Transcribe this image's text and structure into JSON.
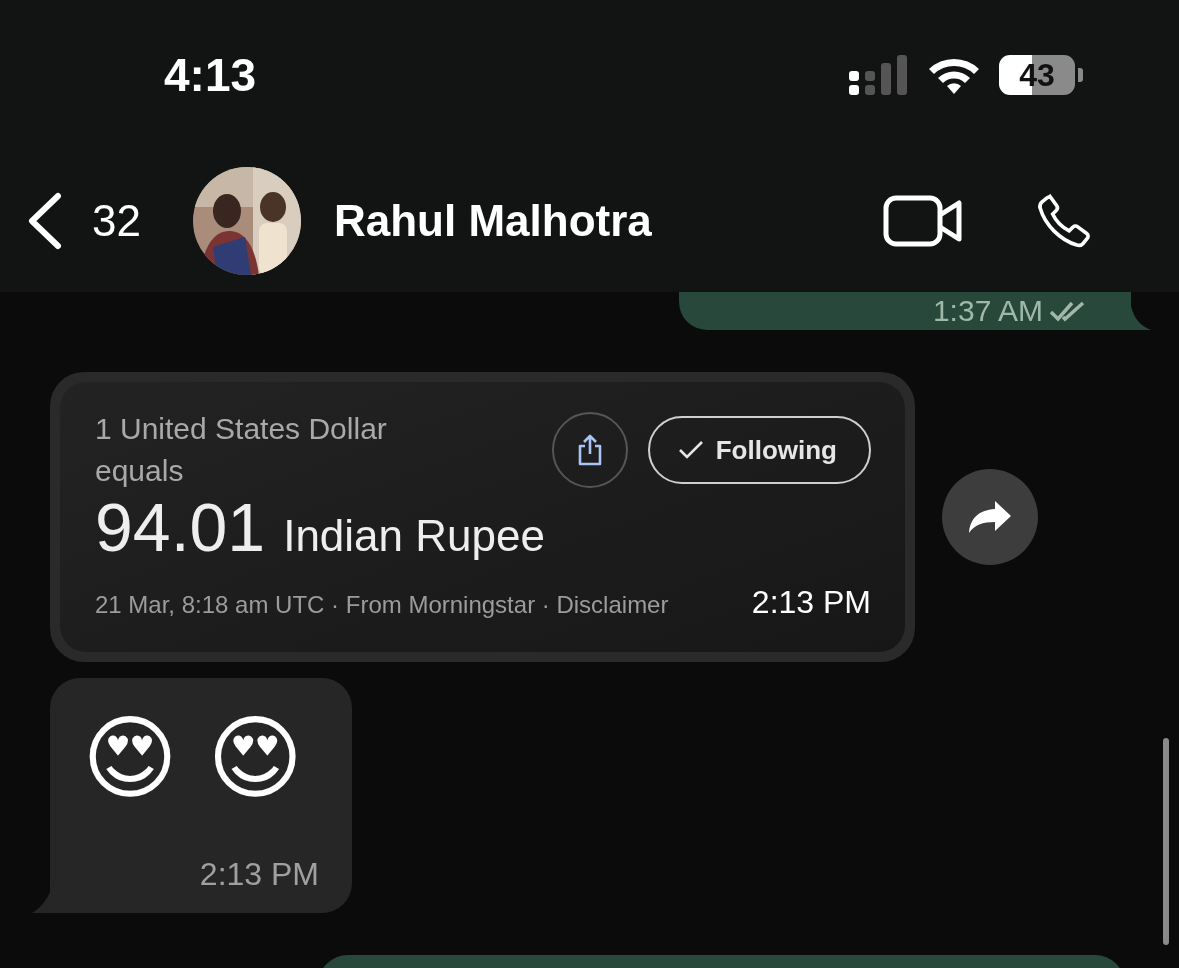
{
  "status_bar": {
    "time": "4:13",
    "battery": "43"
  },
  "header": {
    "back_count": "32",
    "contact_name": "Rahul Malhotra"
  },
  "messages": [
    {
      "kind": "outgoing",
      "time": "1:37 AM"
    },
    {
      "kind": "currency_card",
      "conversion_label": "1 United States Dollar equals",
      "amount": "94.01",
      "currency": "Indian Rupee",
      "follow_button": {
        "label": "Following",
        "following": true
      },
      "footer": "21 Mar, 8:18 am UTC · From Morningstar · Disclaimer",
      "time": "2:13 PM"
    },
    {
      "kind": "incoming",
      "text": "😍 😍",
      "time": "2:13 PM"
    },
    {
      "kind": "outgoing_partial"
    }
  ]
}
